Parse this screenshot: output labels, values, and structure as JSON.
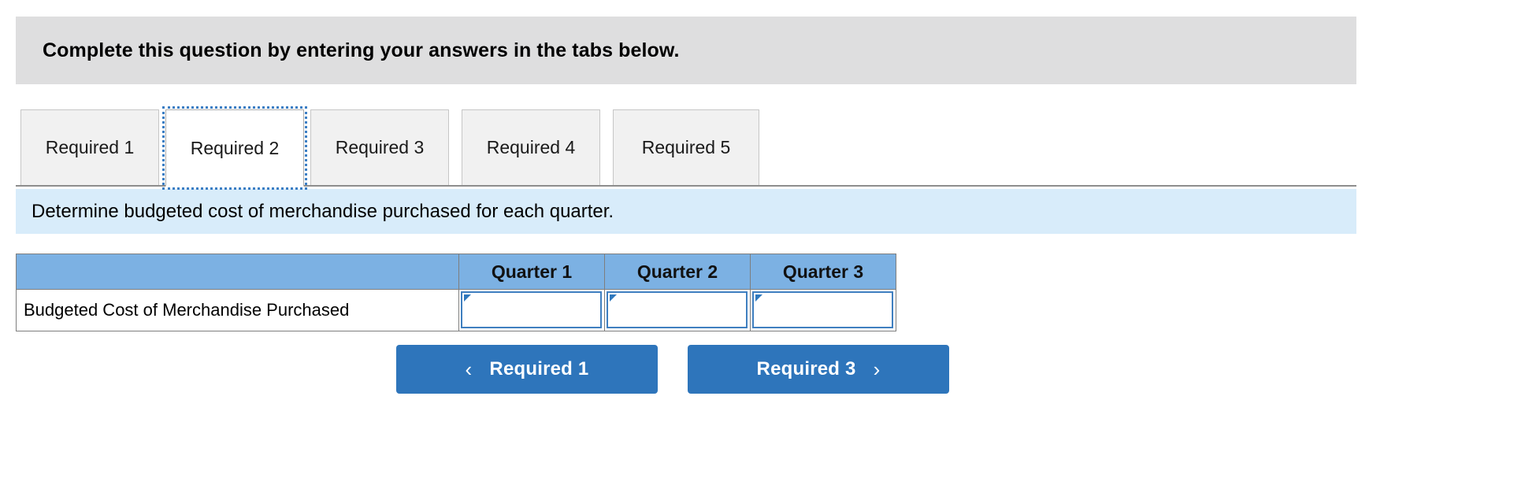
{
  "banner": {
    "text": "Complete this question by entering your answers in the tabs below."
  },
  "tabs": {
    "active_index": 1,
    "items": [
      {
        "label": "Required 1"
      },
      {
        "label": "Required 2"
      },
      {
        "label": "Required 3"
      },
      {
        "label": "Required 4"
      },
      {
        "label": "Required 5"
      }
    ]
  },
  "instruction": {
    "text": "Determine budgeted cost of merchandise purchased for each quarter."
  },
  "table": {
    "headers": [
      "",
      "Quarter 1",
      "Quarter 2",
      "Quarter 3"
    ],
    "rows": [
      {
        "label": "Budgeted Cost of Merchandise Purchased",
        "values": [
          "",
          "",
          ""
        ]
      }
    ]
  },
  "nav": {
    "prev_label": "Required 1",
    "next_label": "Required 3",
    "prev_icon": "chevron-left-icon",
    "next_icon": "chevron-right-icon",
    "chevron_left": "‹",
    "chevron_right": "›"
  },
  "colors": {
    "banner_bg": "#dededf",
    "instruction_bg": "#d8ecfa",
    "table_header_bg": "#7cb1e3",
    "input_border": "#3f7fc0",
    "button_bg": "#2e75bb",
    "tab_bg": "#f1f1f1",
    "focus_outline": "#3b7ec4"
  }
}
